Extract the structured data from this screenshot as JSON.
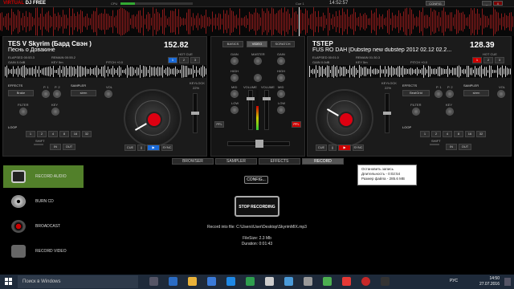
{
  "app": {
    "logo_main": "VIRTUAL",
    "logo_sub": "DJ FREE",
    "cue_label": "Cue 1",
    "meta_left": "CPU",
    "meta_right": "14:52:57",
    "config": "CONFIG",
    "win_min": "_",
    "win_close": "X"
  },
  "deck_left": {
    "title": "TES V  Skyrim (Бард Свэн )",
    "subtitle": "Песнь о Довакине",
    "bpm": "152.82",
    "elapsed": "ELAPSED 00:53.3",
    "remain": "REMAIN 00:55.2",
    "gain": "GAIN 0.0dB",
    "key": "KEY 5m",
    "pitch": "PITCH +0.0",
    "hotcue_label": "HOT CUE",
    "hotcues": [
      "1",
      "2",
      "3"
    ],
    "effects": "EFFECTS",
    "effect_value": "Brake",
    "sampler": "SAMPLER",
    "sampler_value": "siren",
    "p1": "P. 1",
    "p2": "P. 2",
    "vol": "VOL",
    "filter": "FILTER",
    "key_label": "KEY",
    "loop": "LOOP",
    "shift": "SHIFT",
    "in": "IN",
    "out": "OUT",
    "cue": "CUE",
    "play": "▶",
    "sync": "SYNC",
    "keylock": "KEYLOCK",
    "keylock_pct": "22%",
    "loop_values": [
      "1",
      "2",
      "4",
      "8",
      "16",
      "32"
    ]
  },
  "deck_right": {
    "title": "TSTEP",
    "subtitle": "FUS RO DAH [Dubstep new dubstep 2012 02.12 02.2...",
    "bpm": "128.39",
    "elapsed": "ELAPSED 00:01.0",
    "remain": "REMAIN 01:30.3",
    "gain": "GAIN 0.0dB",
    "key": "KEY 5m",
    "pitch": "PITCH +0.0",
    "hotcue_label": "HOT CUE",
    "hotcues": [
      "1",
      "2",
      "3"
    ],
    "effects": "EFFECTS",
    "effect_value": "BeatGrid",
    "sampler": "SAMPLER",
    "sampler_value": "siren",
    "p1": "P. 1",
    "p2": "P. 2",
    "vol": "VOL",
    "filter": "FILTER",
    "key_label": "KEY",
    "loop": "LOOP",
    "shift": "SHIFT",
    "in": "IN",
    "out": "OUT",
    "cue": "CUE",
    "play": "▶",
    "sync": "SYNC",
    "keylock": "KEYLOCK",
    "keylock_pct": "22%",
    "loop_values": [
      "1",
      "2",
      "4",
      "8",
      "16",
      "32"
    ]
  },
  "mixer": {
    "basics": "BASICS",
    "video": "VIDEO",
    "scratch": "SCRATCH",
    "gain": "GAIN",
    "master": "MASTER",
    "high": "HIGH",
    "mid": "MID",
    "low": "LOW",
    "volume": "VOLUME",
    "pfl": "PFL"
  },
  "tabs": [
    "BROWSER",
    "SAMPLER",
    "EFFECTS",
    "RECORD"
  ],
  "tabs_active": 3,
  "sidebar": [
    {
      "label": "RECORD AUDIO",
      "active": true
    },
    {
      "label": "BURN CD",
      "active": false
    },
    {
      "label": "BROADCAST",
      "active": false
    },
    {
      "label": "RECORD VIDEO",
      "active": false
    }
  ],
  "record": {
    "config_btn": "CONFIG...",
    "stop_btn": "STOP RECORDING",
    "file_line": "Record into file: C:\\Users\\User\\Desktop\\SkyrimMIX.mp3",
    "filesize": "FileSize: 2.3 Mb",
    "duration": "Duration: 0:01:43"
  },
  "tooltip": {
    "line1": "Остановить запись",
    "line2": "Длительность - 0:02:54",
    "line3": "Размер файла - 285.6 MB"
  },
  "taskbar": {
    "search": "Поиск в Windows",
    "time": "14:50",
    "date": "27.07.2016",
    "lang": "РУС"
  },
  "colors": {
    "accent_blue": "#1a6ad8",
    "accent_red": "#d01",
    "sidebar_active": "#52802a"
  }
}
